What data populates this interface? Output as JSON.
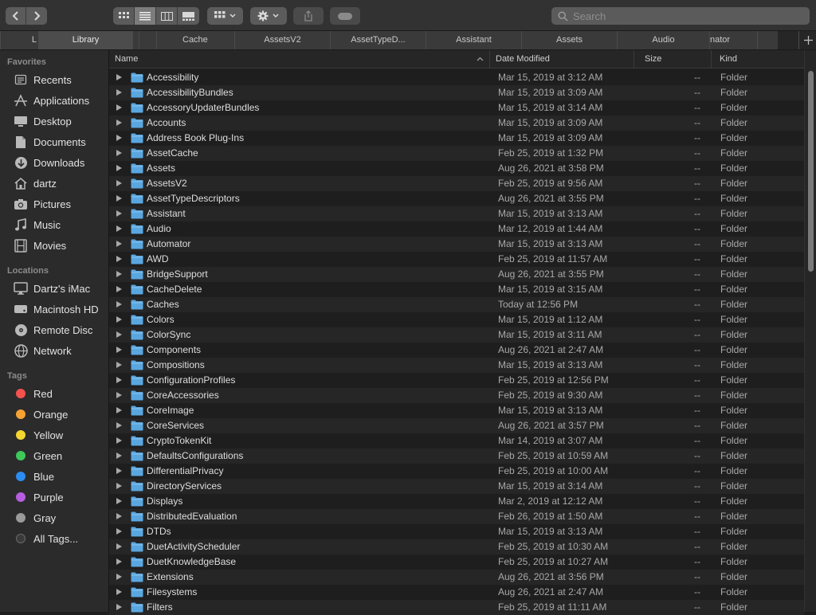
{
  "toolbar": {
    "search_placeholder": "Search"
  },
  "tabs": [
    {
      "label": "L"
    },
    {
      "label": "Library",
      "active": true
    },
    {
      "label": ""
    },
    {
      "label": ""
    },
    {
      "label": "Cache"
    },
    {
      "label": "AssetsV2"
    },
    {
      "label": "AssetTypeD..."
    },
    {
      "label": "Assistant"
    },
    {
      "label": "Assets"
    },
    {
      "label": "Audio"
    },
    {
      "label": "nator"
    },
    {
      "label": ""
    }
  ],
  "sidebar": {
    "favorites_heading": "Favorites",
    "favorites": [
      {
        "label": "Recents",
        "icon": "recents-icon"
      },
      {
        "label": "Applications",
        "icon": "applications-icon"
      },
      {
        "label": "Desktop",
        "icon": "desktop-icon"
      },
      {
        "label": "Documents",
        "icon": "documents-icon"
      },
      {
        "label": "Downloads",
        "icon": "downloads-icon"
      },
      {
        "label": "dartz",
        "icon": "home-icon"
      },
      {
        "label": "Pictures",
        "icon": "pictures-icon"
      },
      {
        "label": "Music",
        "icon": "music-icon"
      },
      {
        "label": "Movies",
        "icon": "movies-icon"
      }
    ],
    "locations_heading": "Locations",
    "locations": [
      {
        "label": "Dartz's iMac",
        "icon": "imac-icon"
      },
      {
        "label": "Macintosh HD",
        "icon": "hard-drive-icon"
      },
      {
        "label": "Remote Disc",
        "icon": "disc-icon"
      },
      {
        "label": "Network",
        "icon": "network-icon"
      }
    ],
    "tags_heading": "Tags",
    "tags": [
      {
        "label": "Red",
        "color": "#f5524f"
      },
      {
        "label": "Orange",
        "color": "#f7a233"
      },
      {
        "label": "Yellow",
        "color": "#f5d530"
      },
      {
        "label": "Green",
        "color": "#3ec95a"
      },
      {
        "label": "Blue",
        "color": "#2d8cf0"
      },
      {
        "label": "Purple",
        "color": "#b65ee0"
      },
      {
        "label": "Gray",
        "color": "#9a9a9a"
      },
      {
        "label": "All Tags...",
        "color": ""
      }
    ]
  },
  "columns": {
    "name": "Name",
    "date_modified": "Date Modified",
    "size": "Size",
    "kind": "Kind"
  },
  "files": [
    {
      "name": "Accessibility",
      "date": "Mar 15, 2019 at 3:12 AM",
      "size": "--",
      "kind": "Folder"
    },
    {
      "name": "AccessibilityBundles",
      "date": "Mar 15, 2019 at 3:09 AM",
      "size": "--",
      "kind": "Folder"
    },
    {
      "name": "AccessoryUpdaterBundles",
      "date": "Mar 15, 2019 at 3:14 AM",
      "size": "--",
      "kind": "Folder"
    },
    {
      "name": "Accounts",
      "date": "Mar 15, 2019 at 3:09 AM",
      "size": "--",
      "kind": "Folder"
    },
    {
      "name": "Address Book Plug-Ins",
      "date": "Mar 15, 2019 at 3:09 AM",
      "size": "--",
      "kind": "Folder"
    },
    {
      "name": "AssetCache",
      "date": "Feb 25, 2019 at 1:32 PM",
      "size": "--",
      "kind": "Folder"
    },
    {
      "name": "Assets",
      "date": "Aug 26, 2021 at 3:58 PM",
      "size": "--",
      "kind": "Folder"
    },
    {
      "name": "AssetsV2",
      "date": "Feb 25, 2019 at 9:56 AM",
      "size": "--",
      "kind": "Folder"
    },
    {
      "name": "AssetTypeDescriptors",
      "date": "Aug 26, 2021 at 3:55 PM",
      "size": "--",
      "kind": "Folder"
    },
    {
      "name": "Assistant",
      "date": "Mar 15, 2019 at 3:13 AM",
      "size": "--",
      "kind": "Folder"
    },
    {
      "name": "Audio",
      "date": "Mar 12, 2019 at 1:44 AM",
      "size": "--",
      "kind": "Folder"
    },
    {
      "name": "Automator",
      "date": "Mar 15, 2019 at 3:13 AM",
      "size": "--",
      "kind": "Folder"
    },
    {
      "name": "AWD",
      "date": "Feb 25, 2019 at 11:57 AM",
      "size": "--",
      "kind": "Folder"
    },
    {
      "name": "BridgeSupport",
      "date": "Aug 26, 2021 at 3:55 PM",
      "size": "--",
      "kind": "Folder"
    },
    {
      "name": "CacheDelete",
      "date": "Mar 15, 2019 at 3:15 AM",
      "size": "--",
      "kind": "Folder"
    },
    {
      "name": "Caches",
      "date": "Today at 12:56 PM",
      "size": "--",
      "kind": "Folder"
    },
    {
      "name": "Colors",
      "date": "Mar 15, 2019 at 1:12 AM",
      "size": "--",
      "kind": "Folder"
    },
    {
      "name": "ColorSync",
      "date": "Mar 15, 2019 at 3:11 AM",
      "size": "--",
      "kind": "Folder"
    },
    {
      "name": "Components",
      "date": "Aug 26, 2021 at 2:47 AM",
      "size": "--",
      "kind": "Folder"
    },
    {
      "name": "Compositions",
      "date": "Mar 15, 2019 at 3:13 AM",
      "size": "--",
      "kind": "Folder"
    },
    {
      "name": "ConfigurationProfiles",
      "date": "Feb 25, 2019 at 12:56 PM",
      "size": "--",
      "kind": "Folder"
    },
    {
      "name": "CoreAccessories",
      "date": "Feb 25, 2019 at 9:30 AM",
      "size": "--",
      "kind": "Folder"
    },
    {
      "name": "CoreImage",
      "date": "Mar 15, 2019 at 3:13 AM",
      "size": "--",
      "kind": "Folder"
    },
    {
      "name": "CoreServices",
      "date": "Aug 26, 2021 at 3:57 PM",
      "size": "--",
      "kind": "Folder"
    },
    {
      "name": "CryptoTokenKit",
      "date": "Mar 14, 2019 at 3:07 AM",
      "size": "--",
      "kind": "Folder"
    },
    {
      "name": "DefaultsConfigurations",
      "date": "Feb 25, 2019 at 10:59 AM",
      "size": "--",
      "kind": "Folder"
    },
    {
      "name": "DifferentialPrivacy",
      "date": "Feb 25, 2019 at 10:00 AM",
      "size": "--",
      "kind": "Folder"
    },
    {
      "name": "DirectoryServices",
      "date": "Mar 15, 2019 at 3:14 AM",
      "size": "--",
      "kind": "Folder"
    },
    {
      "name": "Displays",
      "date": "Mar 2, 2019 at 12:12 AM",
      "size": "--",
      "kind": "Folder"
    },
    {
      "name": "DistributedEvaluation",
      "date": "Feb 26, 2019 at 1:50 AM",
      "size": "--",
      "kind": "Folder"
    },
    {
      "name": "DTDs",
      "date": "Mar 15, 2019 at 3:13 AM",
      "size": "--",
      "kind": "Folder"
    },
    {
      "name": "DuetActivityScheduler",
      "date": "Feb 25, 2019 at 10:30 AM",
      "size": "--",
      "kind": "Folder"
    },
    {
      "name": "DuetKnowledgeBase",
      "date": "Feb 25, 2019 at 10:27 AM",
      "size": "--",
      "kind": "Folder"
    },
    {
      "name": "Extensions",
      "date": "Aug 26, 2021 at 3:56 PM",
      "size": "--",
      "kind": "Folder"
    },
    {
      "name": "Filesystems",
      "date": "Aug 26, 2021 at 2:47 AM",
      "size": "--",
      "kind": "Folder"
    },
    {
      "name": "Filters",
      "date": "Feb 25, 2019 at 11:11 AM",
      "size": "--",
      "kind": "Folder"
    }
  ],
  "colors": {
    "folder": "#5aa7e0"
  }
}
